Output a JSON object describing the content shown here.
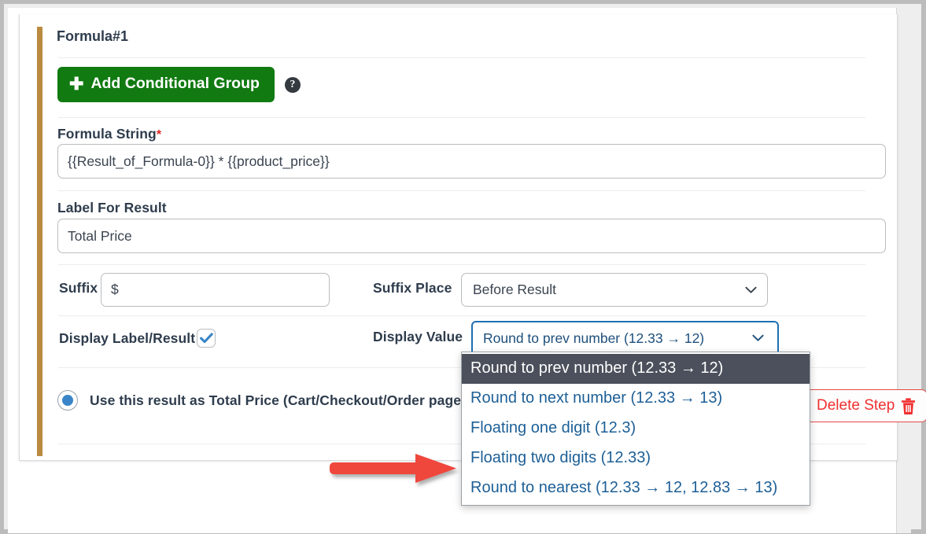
{
  "card": {
    "title": "Formula#1",
    "accent_color": "#b98a3f",
    "add_group_button": {
      "label": "Add Conditional Group",
      "icon": "plus-icon",
      "color": "#117a11"
    },
    "help_icon": "question-mark-icon",
    "fields": {
      "formula_string": {
        "label": "Formula String",
        "required_mark": "*",
        "value": "{{Result_of_Formula-0}} * {{product_price}}"
      },
      "label_for_result": {
        "label": "Label For Result",
        "value": "Total Price"
      },
      "suffix": {
        "label": "Suffix",
        "value": "$"
      },
      "suffix_place": {
        "label": "Suffix Place",
        "value": "Before Result"
      },
      "display_label_result": {
        "label": "Display Label/Result",
        "checked": true
      },
      "display_value": {
        "label": "Display Value",
        "value": "Round to prev number (12.33 → 12)",
        "focused": true,
        "options": [
          "Round to prev number (12.33 → 12)",
          "Round to next number (12.33 → 13)",
          "Floating one digit (12.3)",
          "Floating two digits (12.33)",
          "Round to nearest (12.33 → 12, 12.83 → 13)"
        ],
        "highlighted_index": 0
      }
    },
    "total_price_option": {
      "label": "Use this result as Total Price (Cart/Checkout/Order page)",
      "selected": true
    },
    "delete_step_button": {
      "label": "Delete Step",
      "icon": "trash-icon",
      "color": "#f03030"
    }
  },
  "annotation": {
    "arrow": {
      "name": "red-arrow",
      "color": "#f0463c",
      "points_to": "Floating two digits (12.33)"
    }
  }
}
